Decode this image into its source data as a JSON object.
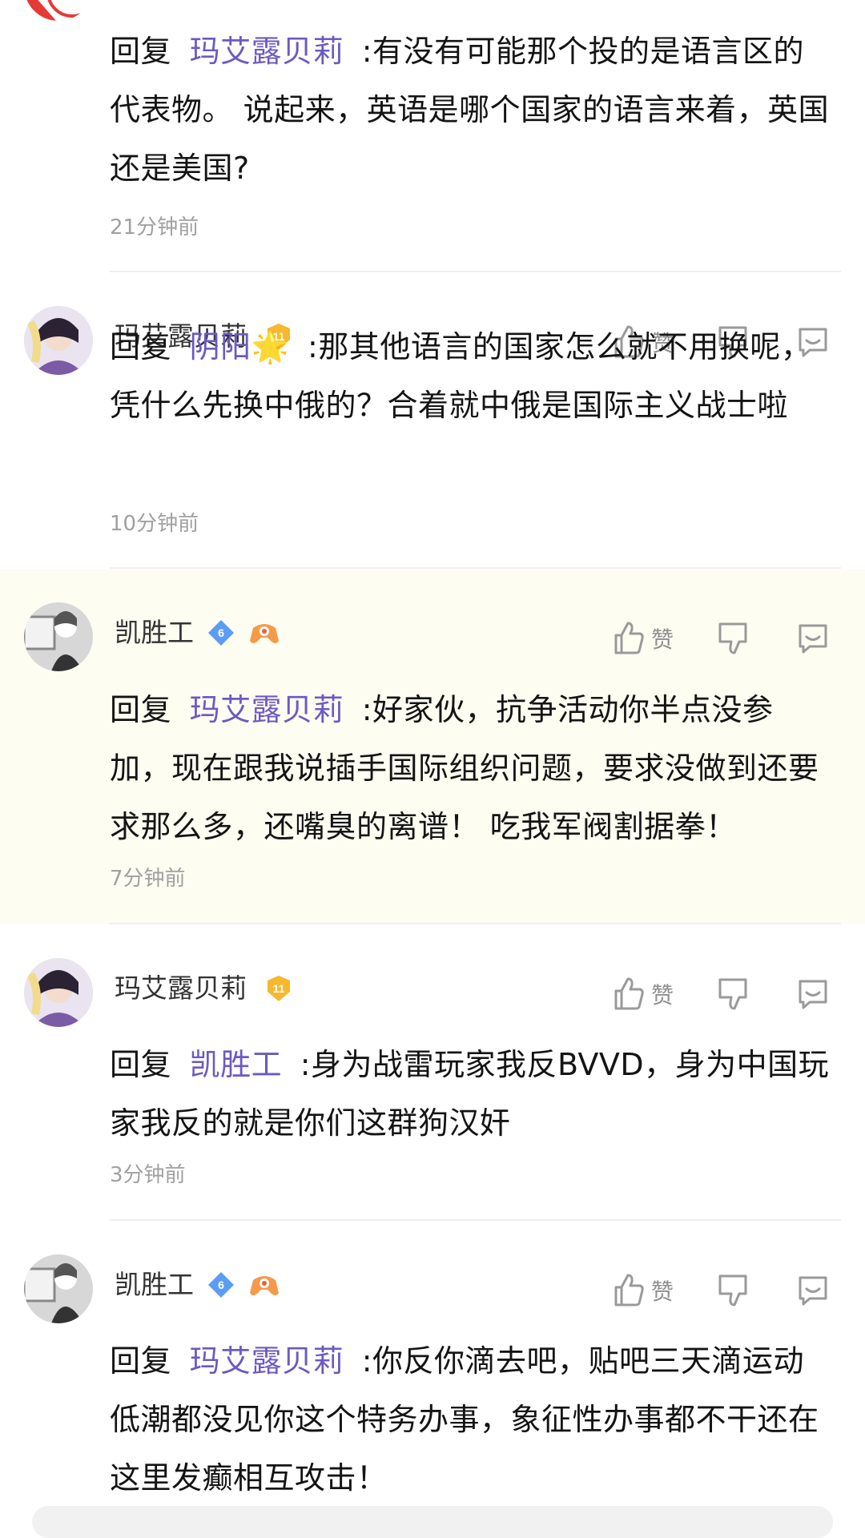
{
  "comments": [
    {
      "reply_prefix": "回复",
      "reply_target": "玛艾露贝莉",
      "content": ":有没有可能那个投的是语言区的代表物。 说起来，英语是哪个国家的语言来着，英国还是美国?",
      "time": "21分钟前"
    },
    {
      "username": "玛艾露贝莉",
      "level": "11",
      "like_label": "赞",
      "reply_prefix": "回复",
      "reply_target": "阴阳",
      "reply_target_emoji": "🌟",
      "content": ":那其他语言的国家怎么就不用换呢，凭什么先换中俄的？合着就中俄是国际主义战士啦",
      "time": "10分钟前"
    },
    {
      "username": "凯胜工",
      "level": "6",
      "like_label": "赞",
      "reply_prefix": "回复",
      "reply_target": "玛艾露贝莉",
      "content": ":好家伙，抗争活动你半点没参加，现在跟我说插手国际组织问题，要求没做到还要求那么多，还嘴臭的离谱！ 吃我军阀割据拳！",
      "time": "7分钟前"
    },
    {
      "username": "玛艾露贝莉",
      "level": "11",
      "like_label": "赞",
      "reply_prefix": "回复",
      "reply_target": "凯胜工",
      "content": ":身为战雷玩家我反BVVD，身为中国玩家我反的就是你们这群狗汉奸",
      "time": "3分钟前"
    },
    {
      "username": "凯胜工",
      "level": "6",
      "like_label": "赞",
      "reply_prefix": "回复",
      "reply_target": "玛艾露贝莉",
      "content": ":你反你滴去吧，贴吧三天滴运动低潮都没见你这个特务办事，象征性办事都不干还在这里发癫相互攻击！"
    }
  ],
  "colors": {
    "link": "#6b5ac2",
    "highlight_bg": "#fdfdf2",
    "level_gold": "#f5b82e",
    "level_blue": "#5b9cf5"
  },
  "icons": [
    "thumbs-up-icon",
    "thumbs-down-icon",
    "reply-bubble-icon",
    "level-badge-icon",
    "game-controller-icon"
  ]
}
